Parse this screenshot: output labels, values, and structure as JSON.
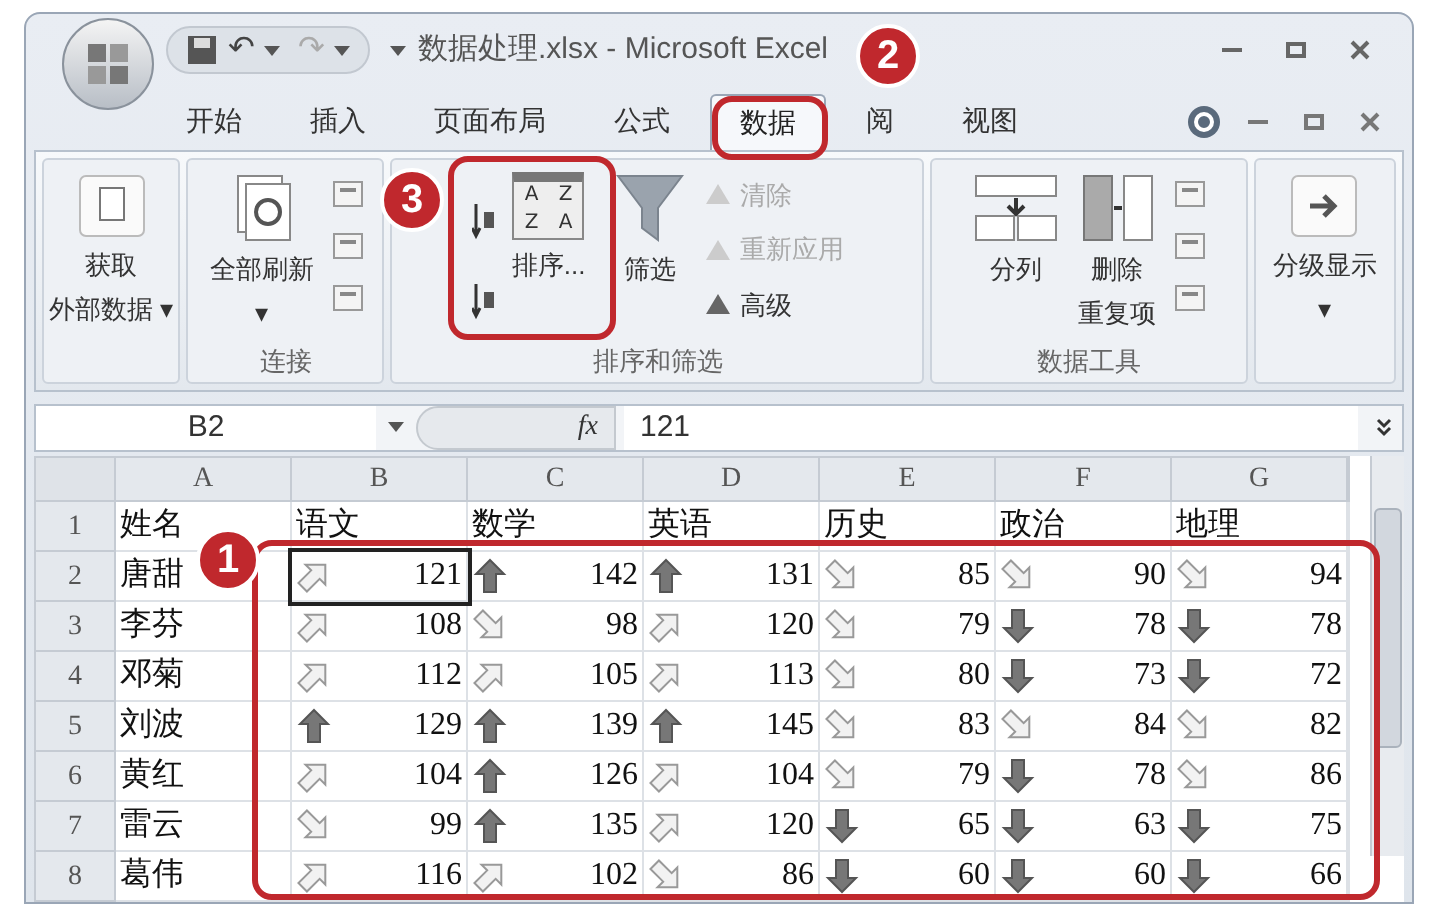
{
  "window": {
    "title": "数据处理.xlsx - Microsoft Excel"
  },
  "quick_access": {
    "undo": "↶",
    "redo": "↷"
  },
  "tabs": [
    {
      "label": "开始",
      "selected": false
    },
    {
      "label": "插入",
      "selected": false
    },
    {
      "label": "页面布局",
      "selected": false
    },
    {
      "label": "公式",
      "selected": false
    },
    {
      "label": "数据",
      "selected": true
    },
    {
      "label": "阅",
      "selected": false
    },
    {
      "label": "视图",
      "selected": false
    }
  ],
  "ribbon": {
    "groups": [
      {
        "items": [
          {
            "kind": "big",
            "lines": [
              "获取",
              "外部数据 ▾"
            ]
          }
        ]
      },
      {
        "label": "连接",
        "items": [
          {
            "kind": "big",
            "lines": [
              "全部刷新",
              "▾"
            ]
          },
          {
            "kind": "smallicons"
          }
        ]
      },
      {
        "label": "排序和筛选",
        "items": [
          {
            "kind": "sorticons"
          },
          {
            "kind": "sortbig",
            "letters": [
              "A",
              "Z",
              "Z",
              "A"
            ],
            "lines": [
              "排序..."
            ]
          },
          {
            "kind": "filter",
            "lines": [
              "筛选"
            ]
          },
          {
            "kind": "smalllist",
            "entries": [
              {
                "label": "清除",
                "disabled": true
              },
              {
                "label": "重新应用",
                "disabled": true
              },
              {
                "label": "高级",
                "disabled": false
              }
            ]
          }
        ]
      },
      {
        "label": "数据工具",
        "items": [
          {
            "kind": "split",
            "lines": [
              "分列"
            ]
          },
          {
            "kind": "dedupe",
            "lines": [
              "删除",
              "重复项"
            ]
          },
          {
            "kind": "smallicons"
          }
        ]
      },
      {
        "items": [
          {
            "kind": "outline",
            "lines": [
              "分级显示",
              "▾"
            ]
          }
        ]
      }
    ]
  },
  "formula_bar": {
    "name_box": "B2",
    "fx": "fx",
    "value": "121"
  },
  "sheet": {
    "columns": [
      "A",
      "B",
      "C",
      "D",
      "E",
      "F",
      "G"
    ],
    "rows": [
      {
        "number": "1",
        "cells": [
          {
            "value": "姓名"
          },
          {
            "value": "语文"
          },
          {
            "value": "数学"
          },
          {
            "value": "英语"
          },
          {
            "value": "历史"
          },
          {
            "value": "政治"
          },
          {
            "value": "地理"
          }
        ]
      },
      {
        "number": "2",
        "cells": [
          {
            "value": "唐甜"
          },
          {
            "kind": "up-right",
            "value": "121"
          },
          {
            "kind": "up",
            "value": "142"
          },
          {
            "kind": "up",
            "value": "131"
          },
          {
            "kind": "down-right",
            "value": "85"
          },
          {
            "kind": "down-right",
            "value": "90"
          },
          {
            "kind": "down-right",
            "value": "94"
          }
        ]
      },
      {
        "number": "3",
        "cells": [
          {
            "value": "李芬"
          },
          {
            "kind": "up-right",
            "value": "108"
          },
          {
            "kind": "down-right",
            "value": "98"
          },
          {
            "kind": "up-right",
            "value": "120"
          },
          {
            "kind": "down-right",
            "value": "79"
          },
          {
            "kind": "down",
            "value": "78"
          },
          {
            "kind": "down",
            "value": "78"
          }
        ]
      },
      {
        "number": "4",
        "cells": [
          {
            "value": "邓菊"
          },
          {
            "kind": "up-right",
            "value": "112"
          },
          {
            "kind": "up-right",
            "value": "105"
          },
          {
            "kind": "up-right",
            "value": "113"
          },
          {
            "kind": "down-right",
            "value": "80"
          },
          {
            "kind": "down",
            "value": "73"
          },
          {
            "kind": "down",
            "value": "72"
          }
        ]
      },
      {
        "number": "5",
        "cells": [
          {
            "value": "刘波"
          },
          {
            "kind": "up",
            "value": "129"
          },
          {
            "kind": "up",
            "value": "139"
          },
          {
            "kind": "up",
            "value": "145"
          },
          {
            "kind": "down-right",
            "value": "83"
          },
          {
            "kind": "down-right",
            "value": "84"
          },
          {
            "kind": "down-right",
            "value": "82"
          }
        ]
      },
      {
        "number": "6",
        "cells": [
          {
            "value": "黄红"
          },
          {
            "kind": "up-right",
            "value": "104"
          },
          {
            "kind": "up",
            "value": "126"
          },
          {
            "kind": "up-right",
            "value": "104"
          },
          {
            "kind": "down-right",
            "value": "79"
          },
          {
            "kind": "down",
            "value": "78"
          },
          {
            "kind": "down-right",
            "value": "86"
          }
        ]
      },
      {
        "number": "7",
        "cells": [
          {
            "value": "雷云"
          },
          {
            "kind": "down-right",
            "value": "99"
          },
          {
            "kind": "up",
            "value": "135"
          },
          {
            "kind": "up-right",
            "value": "120"
          },
          {
            "kind": "down",
            "value": "65"
          },
          {
            "kind": "down",
            "value": "63"
          },
          {
            "kind": "down",
            "value": "75"
          }
        ]
      },
      {
        "number": "8",
        "cells": [
          {
            "value": "葛伟"
          },
          {
            "kind": "up-right",
            "value": "116"
          },
          {
            "kind": "up-right",
            "value": "102"
          },
          {
            "kind": "down-right",
            "value": "86"
          },
          {
            "kind": "down",
            "value": "60"
          },
          {
            "kind": "down",
            "value": "60"
          },
          {
            "kind": "down",
            "value": "66"
          }
        ]
      }
    ]
  },
  "callouts": [
    {
      "label": "1"
    },
    {
      "label": "2"
    },
    {
      "label": "3"
    }
  ]
}
